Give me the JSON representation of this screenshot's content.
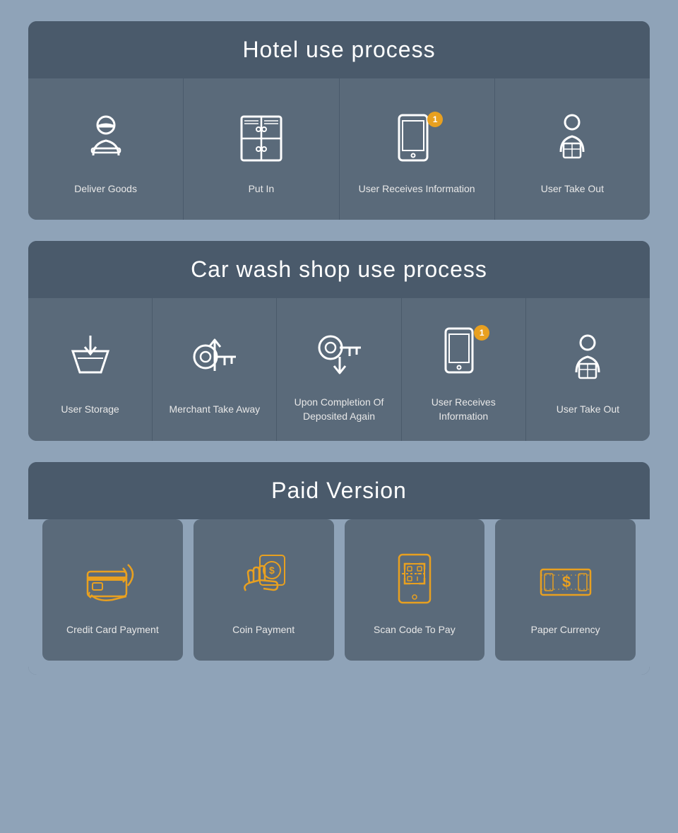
{
  "hotel_section": {
    "title": "Hotel use process",
    "items": [
      {
        "id": "deliver-goods",
        "label": "Deliver Goods",
        "icon": "delivery-man"
      },
      {
        "id": "put-in",
        "label": "Put In",
        "icon": "locker"
      },
      {
        "id": "user-receives",
        "label": "User Receives Information",
        "icon": "phone-notify",
        "badge": "1"
      },
      {
        "id": "user-take-out",
        "label": "User Take Out",
        "icon": "person-box"
      }
    ]
  },
  "carwash_section": {
    "title": "Car wash shop use process",
    "items": [
      {
        "id": "user-storage",
        "label": "User Storage",
        "icon": "storage-tray"
      },
      {
        "id": "merchant-take",
        "label": "Merchant Take Away",
        "icon": "key-up"
      },
      {
        "id": "deposited-again",
        "label": "Upon Completion Of Deposited Again",
        "icon": "key-down"
      },
      {
        "id": "user-receives2",
        "label": "User Receives Information",
        "icon": "phone-notify2",
        "badge": "1"
      },
      {
        "id": "user-take-out2",
        "label": "User Take Out",
        "icon": "person-box2"
      }
    ]
  },
  "paid_section": {
    "title": "Paid Version",
    "items": [
      {
        "id": "credit-card",
        "label": "Credit Card Payment",
        "icon": "credit-card"
      },
      {
        "id": "coin-payment",
        "label": "Coin Payment",
        "icon": "coin"
      },
      {
        "id": "scan-code",
        "label": "Scan Code To Pay",
        "icon": "qr-scan"
      },
      {
        "id": "paper-currency",
        "label": "Paper Currency",
        "icon": "banknote"
      }
    ]
  },
  "colors": {
    "accent": "#e8a020",
    "white": "#ffffff",
    "dark": "#4a5a6b"
  }
}
